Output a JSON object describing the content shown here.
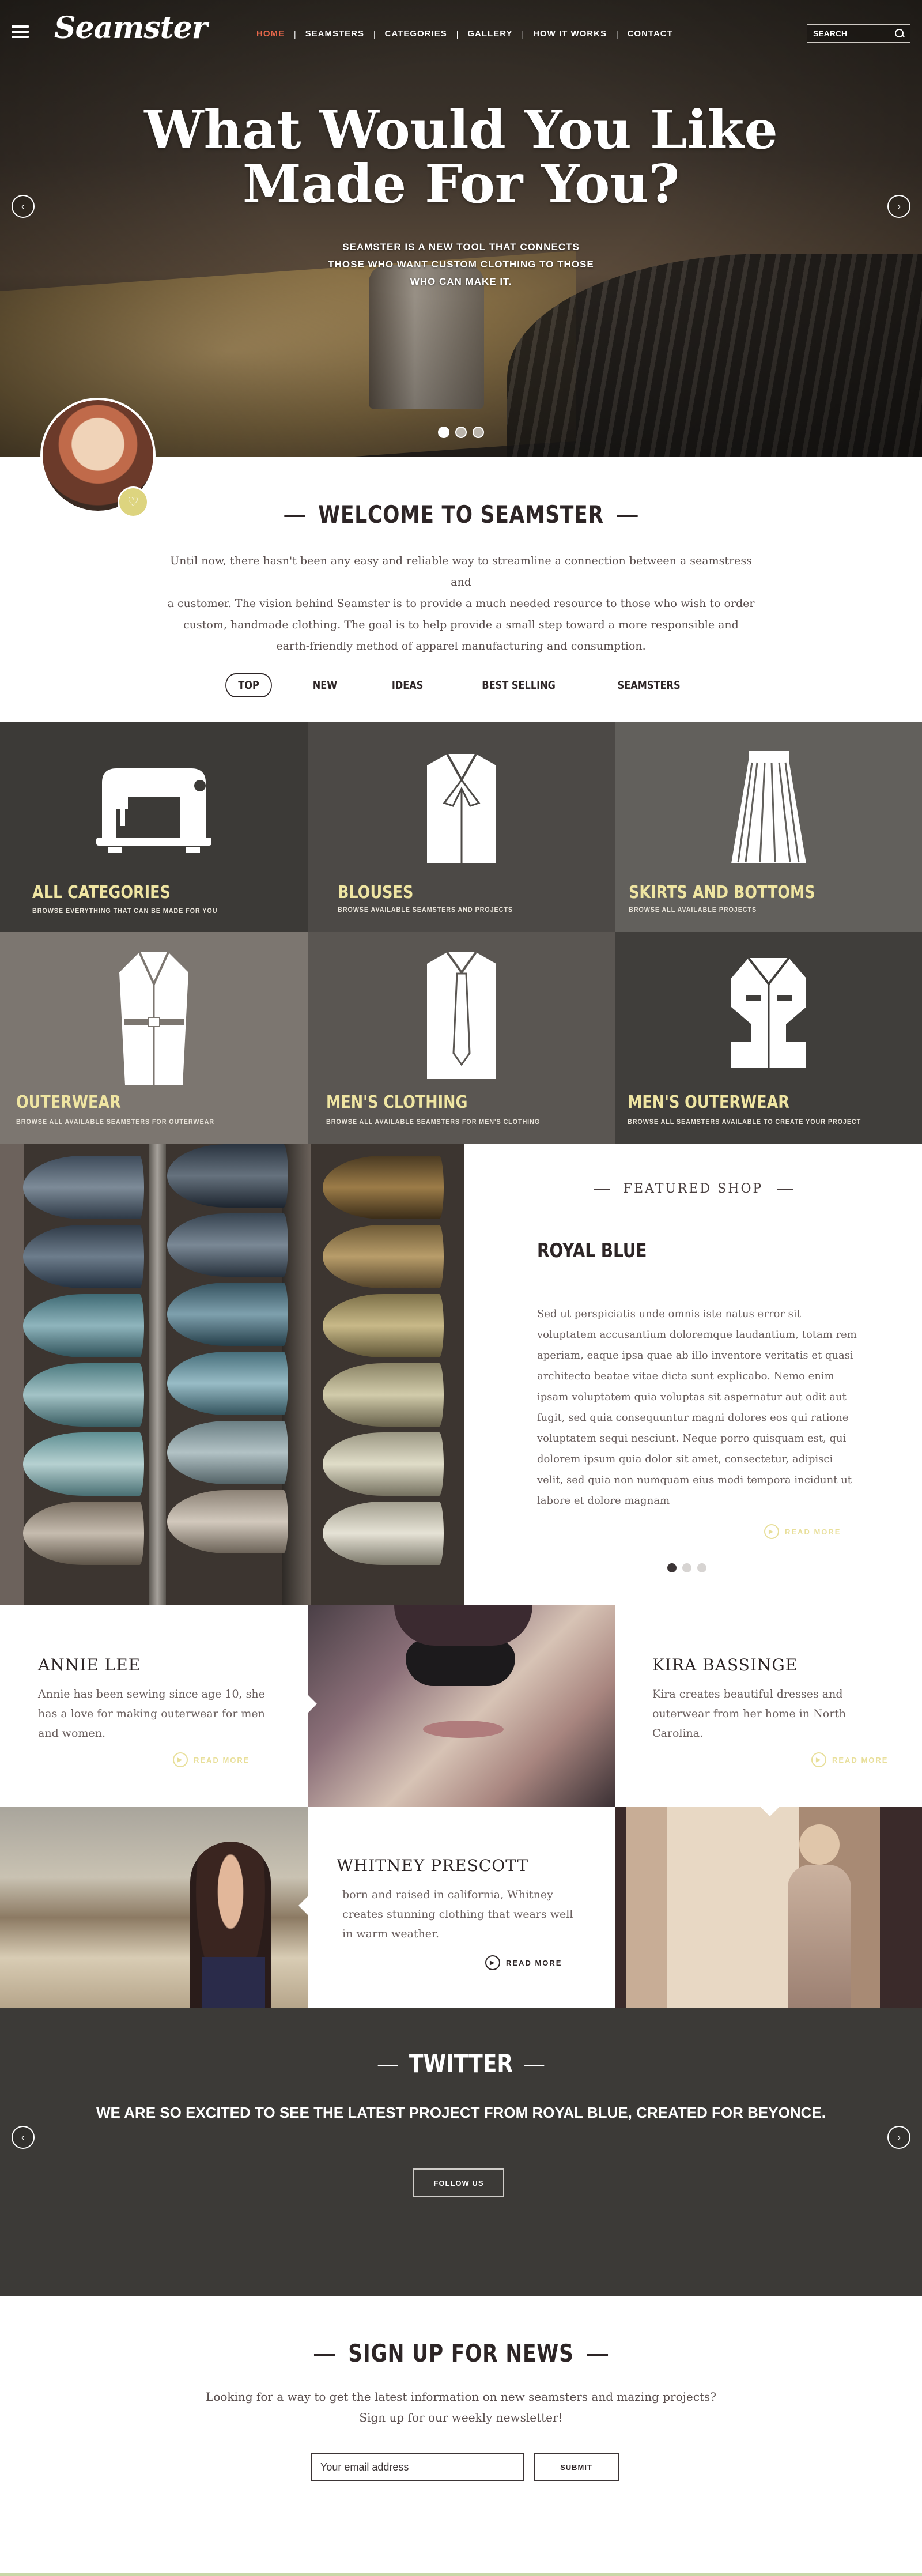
{
  "brand": {
    "logo": "Seamster"
  },
  "nav": {
    "items": [
      {
        "label": "HOME",
        "active": true
      },
      {
        "label": "SEAMSTERS",
        "active": false
      },
      {
        "label": "CATEGORIES",
        "active": false
      },
      {
        "label": "GALLERY",
        "active": false
      },
      {
        "label": "HOW IT WORKS",
        "active": false
      },
      {
        "label": "CONTACT",
        "active": false
      }
    ],
    "separator": "|",
    "search_placeholder": "SEARCH",
    "accent_color": "#e8674a"
  },
  "hero": {
    "title_line1": "What Would You Like",
    "title_line2": "Made For You?",
    "sub_line1": "SEAMSTER IS A NEW TOOL THAT CONNECTS",
    "sub_line2": "THOSE WHO WANT CUSTOM CLOTHING TO THOSE",
    "sub_line3": "WHO CAN MAKE IT.",
    "slides": 3,
    "active_slide": 1
  },
  "welcome": {
    "title": "WELCOME TO SEAMSTER",
    "text_line1": "Until now, there hasn't been any easy and reliable way to streamline a connection between a seamstress and",
    "text_line2": "a customer. The vision behind Seamster is to provide a much needed resource to those who wish to order",
    "text_line3": "custom, handmade clothing. The goal is to help provide a small step toward a more responsible and",
    "text_line4": "earth-friendly method of apparel manufacturing and consumption."
  },
  "tabs": [
    {
      "label": "TOP",
      "active": true
    },
    {
      "label": "NEW",
      "active": false
    },
    {
      "label": "IDEAS",
      "active": false
    },
    {
      "label": "BEST SELLING",
      "active": false
    },
    {
      "label": "SEAMSTERS",
      "active": false
    }
  ],
  "categories": [
    {
      "name": "ALL CATEGORIES",
      "sub": "BROWSE EVERYTHING THAT CAN BE MADE FOR YOU",
      "icon": "sewing-machine-icon",
      "bg": "#3c3a37"
    },
    {
      "name": "BLOUSES",
      "sub": "BROWSE AVAILABLE SEAMSTERS AND PROJECTS",
      "icon": "blouse-icon",
      "bg": "#4c4946"
    },
    {
      "name": "SKIRTS AND BOTTOMS",
      "sub": "BROWSE ALL AVAILABLE PROJECTS",
      "icon": "skirt-icon",
      "bg": "#62605c"
    },
    {
      "name": "OUTERWEAR",
      "sub": "BROWSE ALL AVAILABLE SEAMSTERS FOR OUTERWEAR",
      "icon": "trench-coat-icon",
      "bg": "#7c7670"
    },
    {
      "name": "MEN'S CLOTHING",
      "sub": "BROWSE ALL AVAILABLE SEAMSTERS FOR MEN'S CLOTHING",
      "icon": "shirt-tie-icon",
      "bg": "#5a5652"
    },
    {
      "name": "MEN'S OUTERWEAR",
      "sub": "BROWSE ALL SEAMSTERS AVAILABLE TO CREATE YOUR PROJECT",
      "icon": "vest-icon",
      "bg": "#403e3b"
    }
  ],
  "featured": {
    "heading": "FEATURED SHOP",
    "name": "ROYAL BLUE",
    "text": "Sed ut perspiciatis unde omnis iste natus error sit voluptatem accusantium doloremque laudantium, totam rem aperiam, eaque ipsa quae ab illo inventore veritatis et quasi architecto beatae vitae dicta sunt explicabo. Nemo enim ipsam voluptatem quia voluptas sit aspernatur aut odit aut fugit, sed quia consequuntur magni dolores eos qui ratione voluptatem sequi nesciunt. Neque porro quisquam est, qui dolorem ipsum quia dolor sit amet, consectetur, adipisci velit, sed quia non numquam eius modi tempora incidunt ut labore et dolore magnam",
    "read_more": "READ MORE",
    "slides": 3,
    "active_slide": 0
  },
  "profiles": [
    {
      "name": "ANNIE LEE",
      "desc": "Annie has been sewing since age 10, she has a love for making outerwear for men and women.",
      "read_more": "READ MORE"
    },
    {
      "name": "KIRA BASSINGE",
      "desc": "Kira creates beautiful dresses and outerwear from her home in North Carolina.",
      "read_more": "READ MORE"
    },
    {
      "name": "WHITNEY PRESCOTT",
      "desc": "born and raised in california, Whitney creates stunning clothing that wears well in warm weather.",
      "read_more": "READ MORE"
    }
  ],
  "twitter": {
    "title": "TWITTER",
    "text": "WE ARE SO EXCITED TO SEE THE LATEST PROJECT FROM ROYAL BLUE, CREATED FOR BEYONCE.",
    "follow": "FOLLOW US"
  },
  "newsletter": {
    "title": "SIGN UP FOR NEWS",
    "text_line1": "Looking for a way to get the latest information on new seamsters and mazing projects?",
    "text_line2": "Sign up for our weekly newsletter!",
    "email_placeholder": "Your email address",
    "submit": "SUBMIT"
  }
}
